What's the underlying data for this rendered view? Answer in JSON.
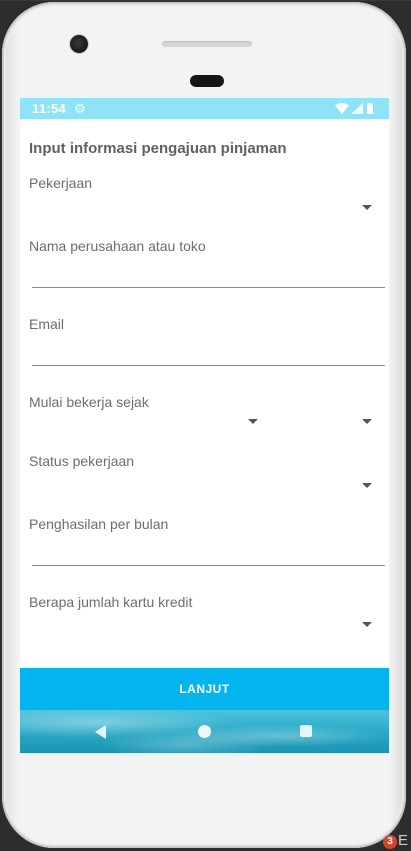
{
  "status_bar": {
    "time": "11:54",
    "settings_icon": "gear-icon",
    "wifi_icon": "wifi-icon",
    "signal_icon": "signal-icon",
    "battery_icon": "battery-icon"
  },
  "form": {
    "title": "Input informasi pengajuan pinjaman",
    "fields": {
      "pekerjaan": {
        "label": "Pekerjaan",
        "type": "dropdown",
        "value": ""
      },
      "nama_perusahaan": {
        "label": "Nama perusahaan atau toko",
        "type": "text",
        "value": ""
      },
      "email": {
        "label": "Email",
        "type": "text",
        "value": ""
      },
      "mulai_bekerja": {
        "label": "Mulai bekerja sejak",
        "type": "dropdown-pair",
        "year": "",
        "month": ""
      },
      "status_pekerjaan": {
        "label": "Status pekerjaan",
        "type": "dropdown",
        "value": ""
      },
      "penghasilan": {
        "label": "Penghasilan per bulan",
        "type": "text",
        "value": ""
      },
      "kartu_kredit": {
        "label": "Berapa jumlah kartu kredit",
        "type": "dropdown",
        "value": ""
      }
    }
  },
  "actions": {
    "lanjut_label": "LANJUT"
  },
  "nav_bar": {
    "back_icon": "back-icon",
    "home_icon": "home-icon",
    "recent_icon": "recent-apps-icon"
  },
  "host": {
    "badge_count": "3",
    "corner_text": "E"
  },
  "colors": {
    "status_bar": "#8fe3f7",
    "primary_button": "#03b4ef",
    "text": "#6d6d6d"
  }
}
